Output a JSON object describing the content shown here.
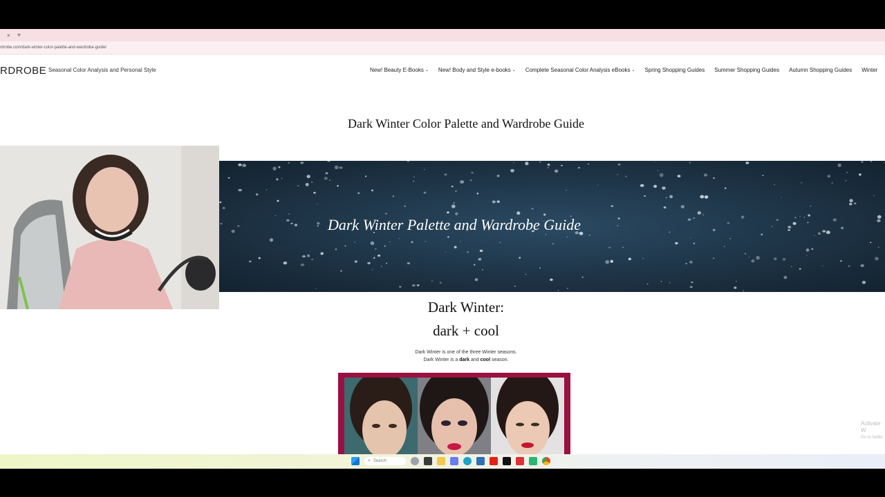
{
  "browser": {
    "tab_close": "×",
    "new_tab": "+",
    "url": "rdrobe.com/dark-winter-color-palette-and-wardrobe-guide/"
  },
  "site": {
    "logo": "RDROBE",
    "tagline": "Seasonal Color Analysis and Personal Style",
    "nav": [
      {
        "label": "New! Beauty E-Books",
        "has_dropdown": true
      },
      {
        "label": "New! Body and Style e-books",
        "has_dropdown": true
      },
      {
        "label": "Complete Seasonal Color Analysis eBooks",
        "has_dropdown": true
      },
      {
        "label": "Spring Shopping Guides",
        "has_dropdown": false
      },
      {
        "label": "Summer Shopping Guides",
        "has_dropdown": false
      },
      {
        "label": "Autumn Shopping Guides",
        "has_dropdown": false
      },
      {
        "label": "Winter",
        "has_dropdown": false
      }
    ],
    "chevron": "⌄"
  },
  "article": {
    "title": "Dark Winter Color Palette and Wardrobe Guide",
    "banner_title": "Dark Winter Palette and Wardrobe Guide",
    "heading": "Dark Winter:",
    "subheading": "dark + cool",
    "para_line1": "Dark Winter is one of the three Winter seasons.",
    "para_line2_pre": "Dark Winter is a ",
    "para_line2_dark": "dark",
    "para_line2_mid": " and ",
    "para_line2_cool": "cool",
    "para_line2_post": " season."
  },
  "overlay": {
    "activate_line1": "Activate W",
    "activate_line2": "Go to Settin"
  },
  "taskbar": {
    "search_placeholder": "Search"
  },
  "colors": {
    "tab_bar": "#f7dfe3",
    "banner": "#1e3346",
    "photo_frame": "#9a1040"
  }
}
